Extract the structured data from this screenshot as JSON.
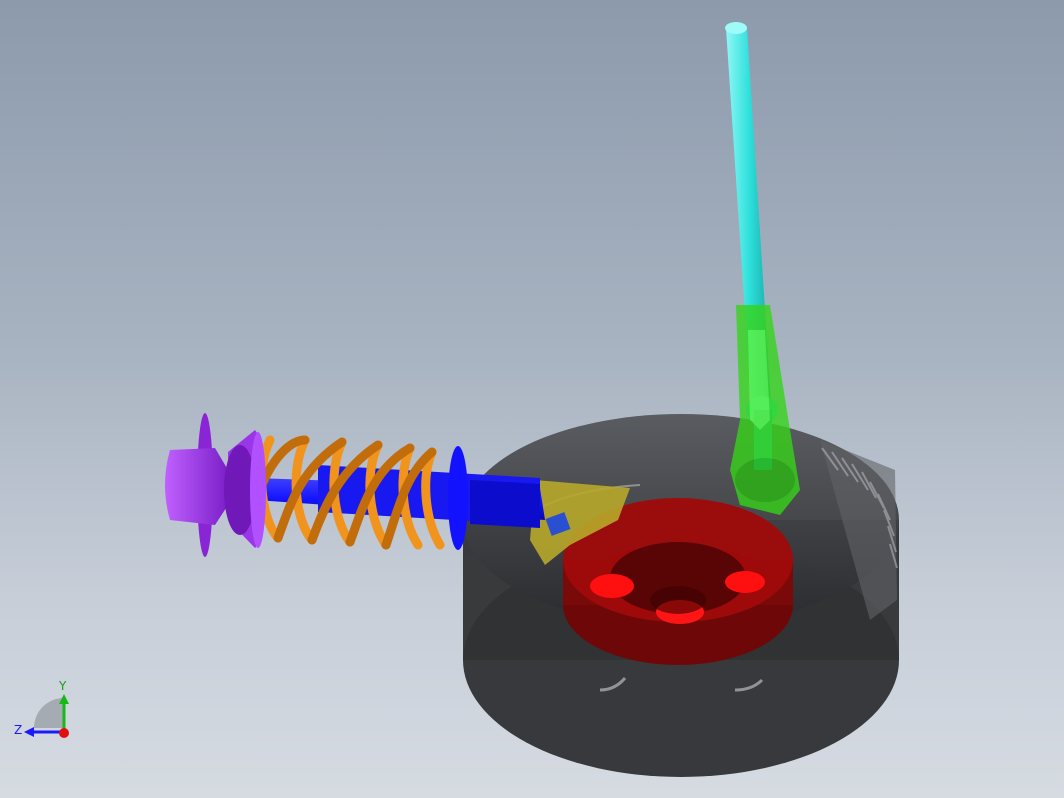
{
  "viewport": {
    "background_top": "#8c9aac",
    "background_bottom": "#d6dbe2"
  },
  "model": {
    "parts": [
      {
        "name": "shock-top-mount",
        "color": "#9a2fe0"
      },
      {
        "name": "coil-spring",
        "color": "#f0941e"
      },
      {
        "name": "damper-rod",
        "color": "#1010ff"
      },
      {
        "name": "knuckle-bracket",
        "color": "#b8a82a"
      },
      {
        "name": "steering-link",
        "color": "#39e6e0"
      },
      {
        "name": "ball-joint",
        "color": "#46e61e"
      },
      {
        "name": "tire",
        "color": "#3a3c40"
      },
      {
        "name": "wheel-hub",
        "color": "#a00a0a"
      }
    ]
  },
  "triad": {
    "y_label": "Y",
    "z_label": "Z"
  }
}
